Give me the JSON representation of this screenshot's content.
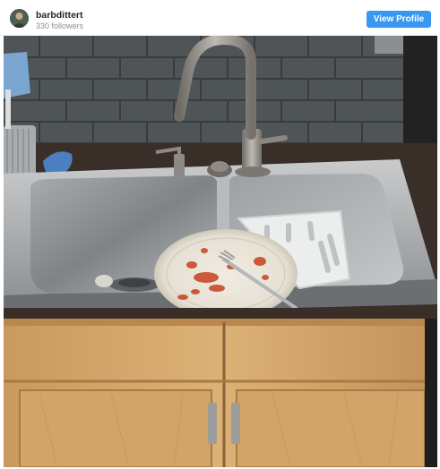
{
  "profile": {
    "username": "barbdittert",
    "followers": "330 followers",
    "view_profile_label": "View Profile"
  },
  "photo": {
    "subject": "kitchen sink with dirty plate and fork",
    "icon": "photo-image"
  },
  "colors": {
    "button_blue": "#3897f0",
    "username_text": "#262626",
    "muted_text": "#8e8e8e"
  }
}
